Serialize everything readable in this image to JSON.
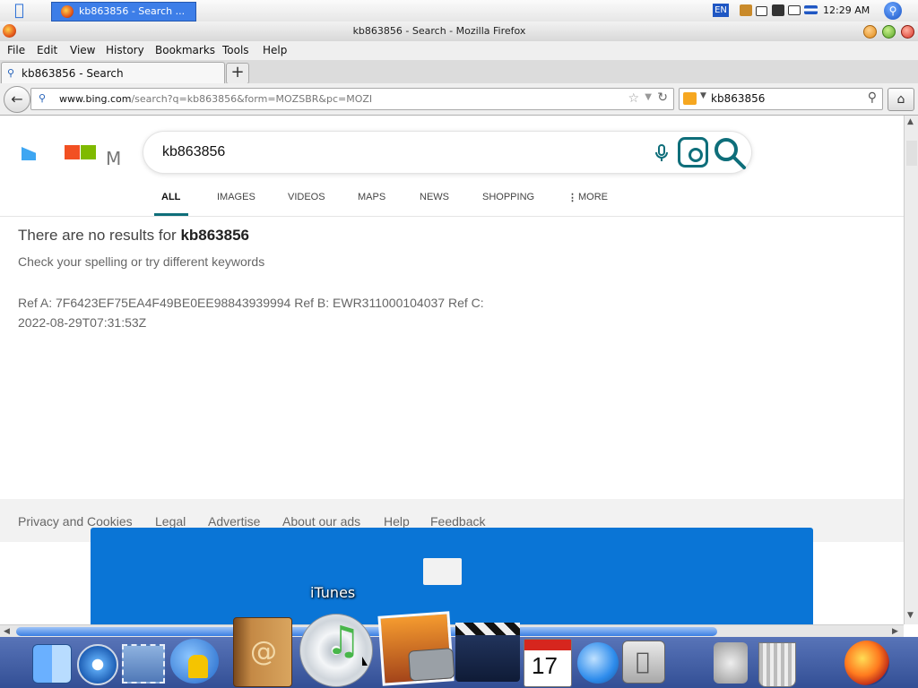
{
  "system_bar": {
    "task_label": "kb863856 - Search ...",
    "language": "EN",
    "clock": "12:29 AM"
  },
  "window": {
    "title": "kb863856 - Search - Mozilla Firefox"
  },
  "menu": [
    "File",
    "Edit",
    "View",
    "History",
    "Bookmarks",
    "Tools",
    "Help"
  ],
  "tab": {
    "label": "kb863856 - Search",
    "new_tab": "+"
  },
  "nav": {
    "url_host": "www.bing.com",
    "url_rest": "/search?q=kb863856&form=MOZSBR&pc=MOZI",
    "search_value": "kb863856"
  },
  "bing": {
    "query": "kb863856",
    "partial_logo_text": "M",
    "tabs": [
      "ALL",
      "IMAGES",
      "VIDEOS",
      "MAPS",
      "NEWS",
      "SHOPPING",
      "MORE"
    ],
    "no_results_prefix": "There are no results for",
    "no_results_query": "kb863856",
    "hint": "Check your spelling or try different keywords",
    "ref_line1": "Ref A: 7F6423EF75EA4F49BE0EE98843939994 Ref B: EWR311000104037 Ref C:",
    "ref_line2": "2022-08-29T07:31:53Z",
    "footer_links": [
      "Privacy and Cookies",
      "Legal",
      "Advertise",
      "About our ads",
      "Help",
      "Feedback"
    ]
  },
  "dock": {
    "hover_label": "iTunes",
    "icons": [
      "finder-icon",
      "safari-icon",
      "mail-icon",
      "ichat-icon",
      "address-book-icon",
      "itunes-icon",
      "iphoto-icon",
      "imovie-icon",
      "ical-icon",
      "quicktime-icon",
      "system-preferences-icon",
      "mail-stamp-icon",
      "trash-icon",
      "firefox-icon"
    ]
  },
  "colors": {
    "bing_teal": "#0e6e7a",
    "panel_blue": "#0a75d6",
    "dock_blue": "#3d5a9e"
  }
}
